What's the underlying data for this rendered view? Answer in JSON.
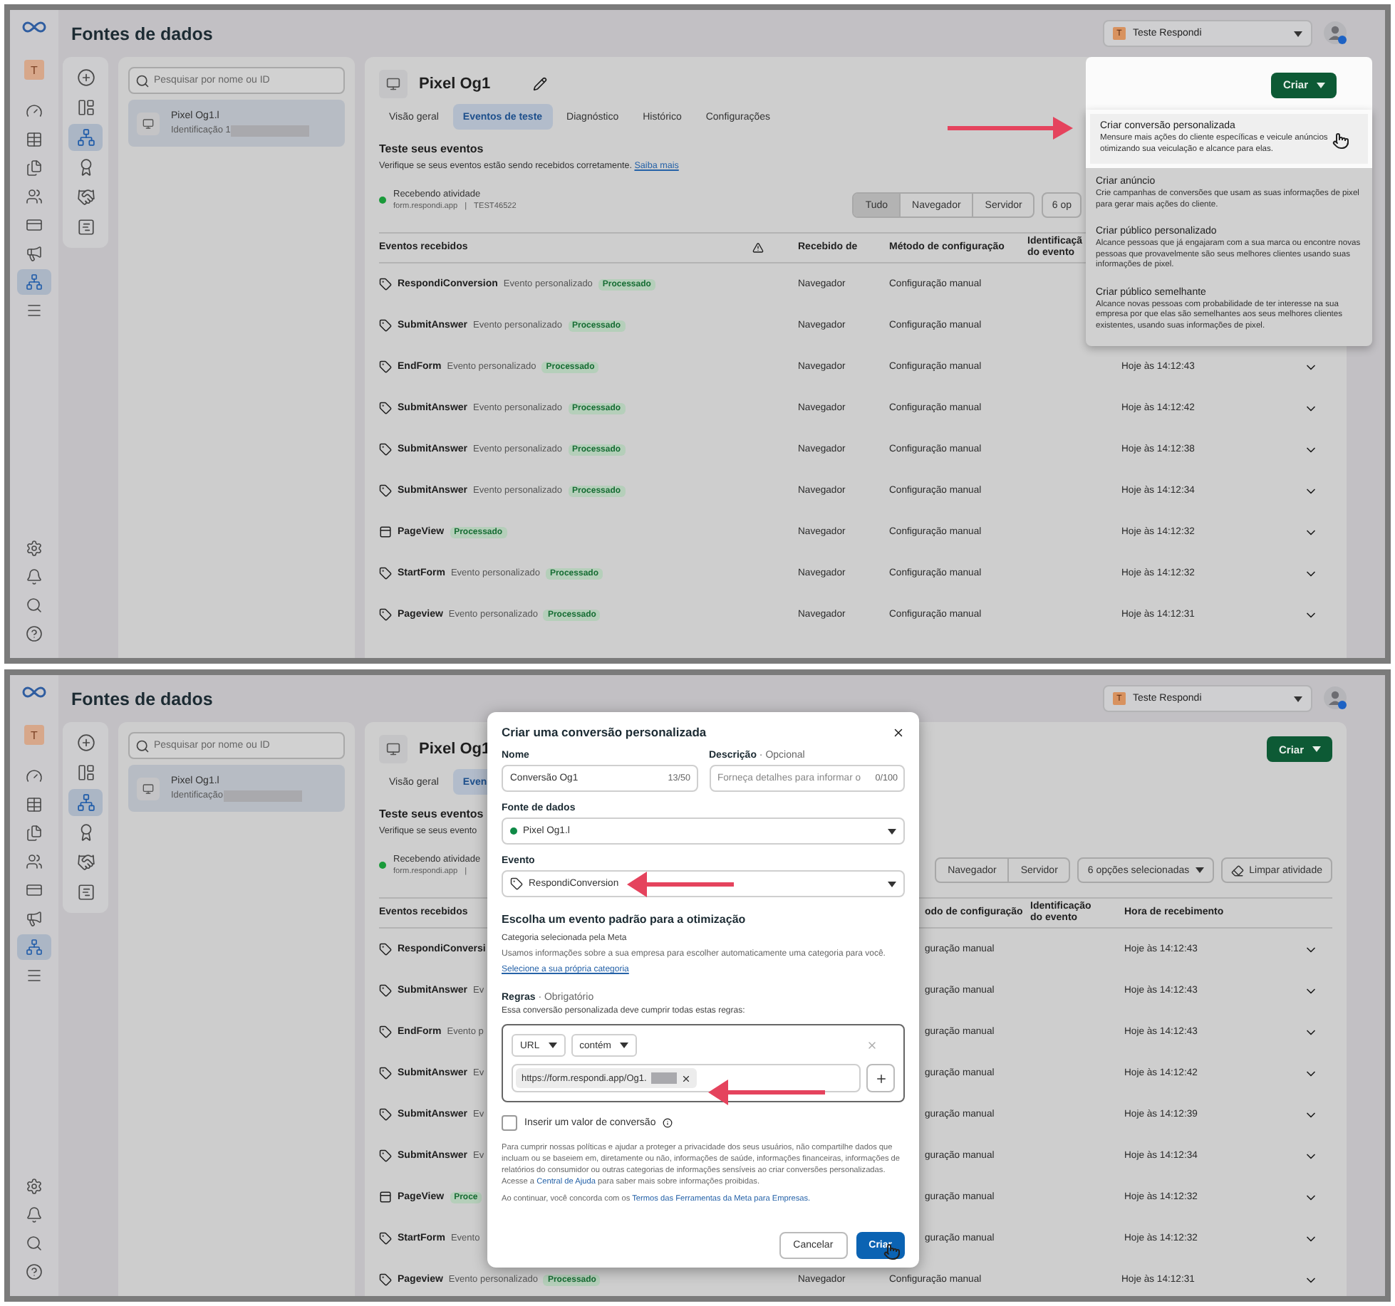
{
  "screens": [
    {
      "kind": "menu",
      "page_title": "Fontes de dados",
      "rail_avatar": "T",
      "rail_items": [
        {
          "kind": "gauge",
          "selected": false
        },
        {
          "kind": "table",
          "selected": false
        },
        {
          "kind": "pages",
          "selected": false
        },
        {
          "kind": "people",
          "selected": false
        },
        {
          "kind": "card",
          "selected": false
        },
        {
          "kind": "megaphone",
          "selected": false
        },
        {
          "kind": "events",
          "selected": true
        },
        {
          "kind": "menu",
          "selected": false
        }
      ],
      "rail_bottom": [
        {
          "kind": "settings"
        },
        {
          "kind": "bell"
        },
        {
          "kind": "search"
        },
        {
          "kind": "help"
        }
      ],
      "tools": [
        {
          "kind": "add",
          "selected": false
        },
        {
          "kind": "layout",
          "selected": false
        },
        {
          "kind": "network",
          "selected": true
        },
        {
          "kind": "badge",
          "selected": false
        },
        {
          "kind": "handshake",
          "selected": false
        },
        {
          "kind": "chart",
          "selected": false
        }
      ],
      "account": {
        "initial": "T",
        "name": "Teste Respondi"
      },
      "search": {
        "placeholder": "Pesquisar por nome ou ID"
      },
      "sources": [
        {
          "name": "Pixel Og1.l",
          "detail": "Identificação 1",
          "selected": true
        }
      ],
      "main": {
        "kind": "full",
        "title": "Pixel Og1",
        "tabs": [
          {
            "label": "Visão geral",
            "selected": false
          },
          {
            "label": "Eventos de teste",
            "selected": true
          },
          {
            "label": "Diagnóstico",
            "selected": false
          },
          {
            "label": "Histórico",
            "selected": false
          },
          {
            "label": "Configurações",
            "selected": false
          }
        ],
        "section_title": "Teste seus eventos",
        "section_text": "Verifique se seus eventos estão sendo recebidos corretamente.",
        "learn_more": "Saiba mais",
        "status": {
          "title": "Recebendo atividade",
          "domain": "form.respondi.app",
          "separator": "|",
          "code": "TEST46522"
        },
        "filters": [
          {
            "label": "Tudo",
            "selected": true
          },
          {
            "label": "Navegador",
            "selected": false
          },
          {
            "label": "Servidor",
            "selected": false
          }
        ],
        "options": "6 op",
        "columns": {
          "name": "Eventos recebidos",
          "source": "Recebido de",
          "method": "Método de configuração",
          "event_id": "Identificaçã do evento"
        },
        "rows": [
          {
            "kind": "custom",
            "name": "RespondiConversion",
            "type": "Evento personalizado",
            "status": "Processado",
            "source": "Navegador",
            "method": "Configuração manual"
          },
          {
            "kind": "custom",
            "name": "SubmitAnswer",
            "type": "Evento personalizado",
            "status": "Processado",
            "source": "Navegador",
            "method": "Configuração manual"
          },
          {
            "kind": "custom",
            "name": "EndForm",
            "type": "Evento personalizado",
            "status": "Processado",
            "source": "Navegador",
            "method": "Configuração manual",
            "time": "Hoje às 14:12:43"
          },
          {
            "kind": "custom",
            "name": "SubmitAnswer",
            "type": "Evento personalizado",
            "status": "Processado",
            "source": "Navegador",
            "method": "Configuração manual",
            "time": "Hoje às 14:12:42"
          },
          {
            "kind": "custom",
            "name": "SubmitAnswer",
            "type": "Evento personalizado",
            "status": "Processado",
            "source": "Navegador",
            "method": "Configuração manual",
            "time": "Hoje às 14:12:38"
          },
          {
            "kind": "custom",
            "name": "SubmitAnswer",
            "type": "Evento personalizado",
            "status": "Processado",
            "source": "Navegador",
            "method": "Configuração manual",
            "time": "Hoje às 14:12:34"
          },
          {
            "kind": "standard",
            "name": "PageView",
            "status": "Processado",
            "source": "Navegador",
            "method": "Configuração manual",
            "time": "Hoje às 14:12:32"
          },
          {
            "kind": "custom",
            "name": "StartForm",
            "type": "Evento personalizado",
            "status": "Processado",
            "source": "Navegador",
            "method": "Configuração manual",
            "time": "Hoje às 14:12:32"
          },
          {
            "kind": "custom",
            "name": "Pageview",
            "type": "Evento personalizado",
            "status": "Processado",
            "source": "Navegador",
            "method": "Configuração manual",
            "time": "Hoje às 14:12:31"
          }
        ]
      },
      "menu": {
        "create_button": "Criar",
        "items": [
          {
            "title": "Criar conversão personalizada",
            "text": "Mensure mais ações do cliente específicas e veicule anúncios otimizando sua veiculação e alcance para elas.",
            "selected": true
          },
          {
            "title": "Criar anúncio",
            "text": "Crie campanhas de conversões que usam as suas informações de pixel para gerar mais ações do cliente.",
            "selected": false
          },
          {
            "title": "Criar público personalizado",
            "text": "Alcance pessoas que já engajaram com a sua marca ou encontre novas pessoas que provavelmente são seus melhores clientes usando suas informações de pixel.",
            "selected": false
          },
          {
            "title": "Criar público semelhante",
            "text": "Alcance novas pessoas com probabilidade de ter interesse na sua empresa por que elas são semelhantes aos seus melhores clientes existentes, usando suas informações de pixel.",
            "selected": false
          }
        ]
      }
    },
    {
      "kind": "dialog",
      "page_title": "Fontes de dados",
      "rail_avatar": "T",
      "rail_items": [
        {
          "kind": "gauge",
          "selected": false
        },
        {
          "kind": "table",
          "selected": false
        },
        {
          "kind": "pages",
          "selected": false
        },
        {
          "kind": "people",
          "selected": false
        },
        {
          "kind": "card",
          "selected": false
        },
        {
          "kind": "megaphone",
          "selected": false
        },
        {
          "kind": "events",
          "selected": true
        },
        {
          "kind": "menu",
          "selected": false
        }
      ],
      "rail_bottom": [
        {
          "kind": "settings"
        },
        {
          "kind": "bell"
        },
        {
          "kind": "search"
        },
        {
          "kind": "help"
        }
      ],
      "tools": [
        {
          "kind": "add",
          "selected": false
        },
        {
          "kind": "layout",
          "selected": false
        },
        {
          "kind": "network",
          "selected": true
        },
        {
          "kind": "badge",
          "selected": false
        },
        {
          "kind": "handshake",
          "selected": false
        },
        {
          "kind": "chart",
          "selected": false
        }
      ],
      "account": {
        "initial": "T",
        "name": "Teste Respondi"
      },
      "search": {
        "placeholder": "Pesquisar por nome ou ID"
      },
      "sources": [
        {
          "name": "Pixel Og1.l",
          "detail": "Identificação",
          "selected": true
        }
      ],
      "main": {
        "kind": "split",
        "title": "Pixel Og1",
        "create_button": "Criar",
        "tabs": [
          {
            "label": "Visão geral",
            "selected": false
          },
          {
            "label": "Even",
            "selected": true
          }
        ],
        "section_title": "Teste seus eventos",
        "section_text": "Verifique se seus evento",
        "status": {
          "title": "Recebendo atividade",
          "domain": "form.respondi.app",
          "separator": "|"
        },
        "filters": [
          {
            "label": "Navegador",
            "selected": false
          },
          {
            "label": "Servidor",
            "selected": false
          }
        ],
        "options": "6 opções selecionadas",
        "clear": "Limpar atividade",
        "columns": {
          "name": "Eventos recebidos",
          "method": "odo de configuração",
          "event_id": "Identificação do evento",
          "time": "Hora de recebimento"
        },
        "rows": [
          {
            "kind": "custom",
            "name": "RespondiConversi",
            "method": "guração manual",
            "time": "Hoje às 14:12:43"
          },
          {
            "kind": "custom",
            "name": "SubmitAnswer",
            "type": "Ev",
            "method": "guração manual",
            "time": "Hoje às 14:12:43"
          },
          {
            "kind": "custom",
            "name": "EndForm",
            "type": "Evento p",
            "method": "guração manual",
            "time": "Hoje às 14:12:43"
          },
          {
            "kind": "custom",
            "name": "SubmitAnswer",
            "type": "Ev",
            "method": "guração manual",
            "time": "Hoje às 14:12:42"
          },
          {
            "kind": "custom",
            "name": "SubmitAnswer",
            "type": "Ev",
            "method": "guração manual",
            "time": "Hoje às 14:12:39"
          },
          {
            "kind": "custom",
            "name": "SubmitAnswer",
            "type": "Ev",
            "method": "guração manual",
            "time": "Hoje às 14:12:34"
          },
          {
            "kind": "standard",
            "name": "PageView",
            "status": "Proce",
            "method": "guração manual",
            "time": "Hoje às 14:12:32"
          },
          {
            "kind": "custom",
            "name": "StartForm",
            "type": "Evento",
            "method": "guração manual",
            "time": "Hoje às 14:12:32"
          }
        ],
        "rows_below": [
          {
            "kind": "custom",
            "name": "Pageview",
            "type": "Evento personalizado",
            "status": "Processado",
            "source": "Navegador",
            "method": "Configuração manual",
            "time": "Hoje às 14:12:31"
          }
        ]
      },
      "dialog": {
        "title": "Criar uma conversão personalizada",
        "name_label": "Nome",
        "name_value": "Conversão Og1",
        "name_count": "13/50",
        "description_label": "Descrição",
        "description_hint": "· Opcional",
        "description_placeholder": "Forneça detalhes para informar o",
        "description_count": "0/100",
        "source_label": "Fonte de dados",
        "source_value": "Pixel Og1.l",
        "event_label": "Evento",
        "event_value": "RespondiConversion",
        "optimization_title": "Escolha um evento padrão para a otimização",
        "category_label": "Categoria selecionada pela Meta",
        "category_text": "Usamos informações sobre a sua empresa para escolher automaticamente uma categoria para você.",
        "category_link": "Selecione a sua própria categoria",
        "rules_label": "Regras",
        "rules_hint": "· Obrigatório",
        "rules_text": "Essa conversão personalizada deve cumprir todas estas regras:",
        "rule": {
          "field": "URL",
          "operator": "contém",
          "value": "https://form.respondi.app/Og1."
        },
        "conversion_value": {
          "label": "Inserir um valor de conversão",
          "checked": false
        },
        "policy_before": "Para cumprir nossas políticas e ajudar a proteger a privacidade dos seus usuários, não compartilhe dados que incluam ou se baseiem em, diretamente ou não, informações de saúde, informações financeiras, informações de relatórios do consumidor ou outras categorias de informações sensíveis ao criar conversões personalizadas. Acesse a",
        "policy_link": "Central de Ajuda",
        "policy_after": "para saber mais sobre informações proibidas.",
        "terms_before": "Ao continuar, você concorda com os",
        "terms_link": "Termos das Ferramentas da Meta para Empresas.",
        "buttons": [
          {
            "label": "Cancelar",
            "kind": "secondary"
          },
          {
            "label": "Criar",
            "kind": "primary"
          }
        ]
      }
    }
  ]
}
